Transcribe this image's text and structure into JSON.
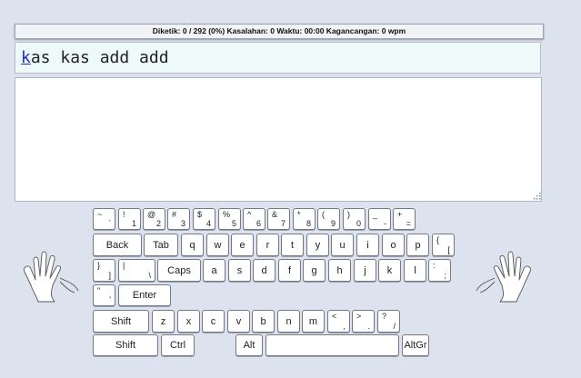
{
  "status": {
    "text": "Diketik: 0 / 292 (0%) Kasalahan: 0 Waktu: 00:00 Kagancangan: 0 wpm"
  },
  "prompt": {
    "current": "k",
    "rest": "as kas add add"
  },
  "input": {
    "value": ""
  },
  "icons": {
    "left_hand": "left-hand-icon",
    "right_hand": "right-hand-icon",
    "resize": "resize-grip-icon"
  },
  "keyboard": {
    "row1": [
      {
        "u": "~",
        "l": "`"
      },
      {
        "u": "!",
        "l": "1"
      },
      {
        "u": "@",
        "l": "2"
      },
      {
        "u": "#",
        "l": "3"
      },
      {
        "u": "$",
        "l": "4"
      },
      {
        "u": "%",
        "l": "5"
      },
      {
        "u": "^",
        "l": "6"
      },
      {
        "u": "&",
        "l": "7"
      },
      {
        "u": "*",
        "l": "8"
      },
      {
        "u": "(",
        "l": "9"
      },
      {
        "u": ")",
        "l": "0"
      },
      {
        "u": "_",
        "l": "-"
      },
      {
        "u": "+",
        "l": "="
      }
    ],
    "row2": [
      "Back",
      "Tab",
      "q",
      "w",
      "e",
      "r",
      "t",
      "y",
      "u",
      "i",
      "o",
      "p"
    ],
    "row2_extra": {
      "u": "{",
      "l": "["
    },
    "row3_lead": [
      {
        "u": "}",
        "l": "]"
      },
      {
        "u": "|",
        "l": "\\"
      }
    ],
    "row3": [
      "Caps",
      "a",
      "s",
      "d",
      "f",
      "g",
      "h",
      "j",
      "k",
      "l"
    ],
    "row3_extra": {
      "u": ":",
      "l": ";"
    },
    "row4_lead": {
      "u": "\"",
      "l": "'"
    },
    "row4": [
      "Enter"
    ],
    "row5": [
      "Shift",
      "z",
      "x",
      "c",
      "v",
      "b",
      "n",
      "m"
    ],
    "row5_extra": [
      {
        "u": "<",
        "l": ","
      },
      {
        "u": ">",
        "l": "."
      },
      {
        "u": "?",
        "l": "/"
      }
    ],
    "row6": [
      "Shift",
      "Ctrl",
      "Alt",
      "",
      "AltGr"
    ]
  }
}
